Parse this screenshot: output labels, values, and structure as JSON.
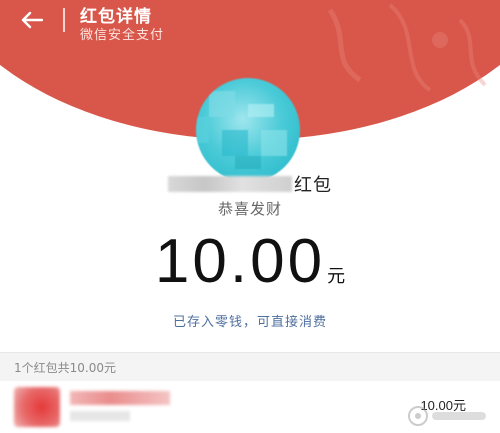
{
  "header": {
    "title": "红包详情",
    "subtitle": "微信安全支付",
    "color": "#d9574a"
  },
  "icons": {
    "back": "back-arrow-icon"
  },
  "envelope": {
    "sender_suffix": "红包",
    "greeting": "恭喜发财",
    "amount": "10.00",
    "unit": "元",
    "stored_note": "已存入零钱，可直接消费",
    "note_color": "#4f6f9f"
  },
  "summary": {
    "text": "1个红包共10.00元"
  },
  "records": [
    {
      "amount": "10.00元"
    }
  ]
}
